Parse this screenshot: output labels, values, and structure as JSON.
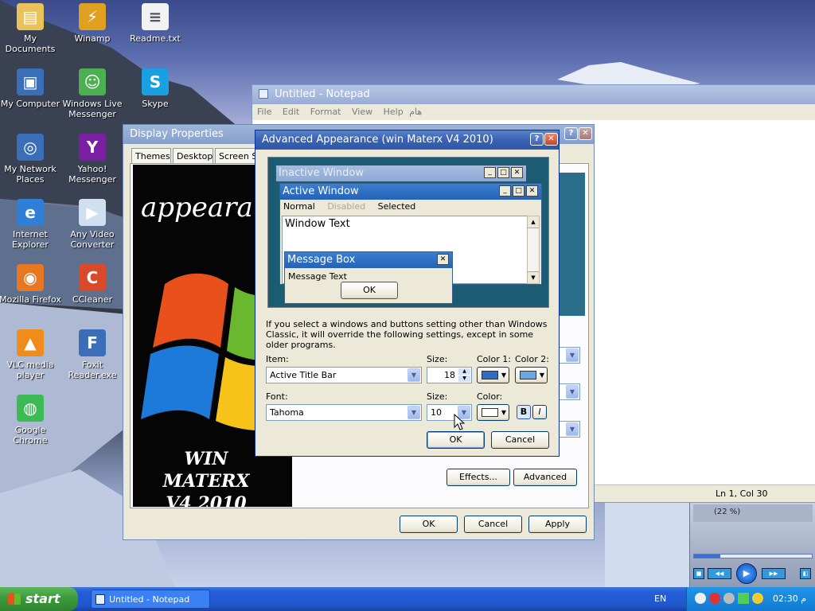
{
  "desktop_icons": [
    {
      "label": "My Documents",
      "icon": "folder-icon",
      "color": "#e8c25a"
    },
    {
      "label": "Winamp",
      "icon": "winamp-icon",
      "color": "#e0a020"
    },
    {
      "label": "Readme.txt",
      "icon": "text-file-icon",
      "color": "#f2f2f2"
    },
    {
      "label": "My Computer",
      "icon": "computer-icon",
      "color": "#3a6fb8"
    },
    {
      "label": "Windows Live Messenger",
      "icon": "messenger-icon",
      "color": "#4caf50"
    },
    {
      "label": "Skype",
      "icon": "skype-icon",
      "color": "#1aa0e0"
    },
    {
      "label": "My Network Places",
      "icon": "network-icon",
      "color": "#3a6fb8"
    },
    {
      "label": "Yahoo! Messenger",
      "icon": "yahoo-icon",
      "color": "#7b1fa2"
    },
    {
      "label": "Internet Explorer",
      "icon": "ie-icon",
      "color": "#2f7fd6"
    },
    {
      "label": "Any Video Converter",
      "icon": "video-converter-icon",
      "color": "#d0e0f0"
    },
    {
      "label": "Mozilla Firefox",
      "icon": "firefox-icon",
      "color": "#e87722"
    },
    {
      "label": "CCleaner",
      "icon": "ccleaner-icon",
      "color": "#d84a2a"
    },
    {
      "label": "VLC media player",
      "icon": "vlc-icon",
      "color": "#f08c1a"
    },
    {
      "label": "Foxit Reader.exe",
      "icon": "foxit-icon",
      "color": "#3a6fb8"
    },
    {
      "label": "Google Chrome",
      "icon": "chrome-icon",
      "color": "#3cba54"
    }
  ],
  "notepad": {
    "title": "Untitled - Notepad",
    "menu": [
      "File",
      "Edit",
      "Format",
      "View",
      "Help",
      "هام"
    ],
    "status": "Ln 1, Col 30"
  },
  "display_properties": {
    "title": "Display Properties",
    "tabs": [
      "Themes",
      "Desktop",
      "Screen Sa"
    ],
    "preview_text": "appearan",
    "preview_brand": "WIN MATERX V4 2010",
    "effects": "Effects...",
    "advanced": "Advanced",
    "ok": "OK",
    "cancel": "Cancel",
    "apply": "Apply"
  },
  "advanced_appearance": {
    "title": "Advanced Appearance (win  Materx V4 2010)",
    "preview": {
      "inactive": "Inactive Window",
      "active": "Active Window",
      "menu_normal": "Normal",
      "menu_disabled": "Disabled",
      "menu_selected": "Selected",
      "window_text": "Window Text",
      "msgbox_title": "Message Box",
      "msgbox_text": "Message Text",
      "msgbox_ok": "OK"
    },
    "info": "If you select a windows and buttons setting other than Windows Classic, it will override the following settings, except in some older programs.",
    "item_label": "Item:",
    "item_value": "Active Title Bar",
    "size_label": "Size:",
    "size_value": "18",
    "color1_label": "Color 1:",
    "color2_label": "Color 2:",
    "font_label": "Font:",
    "font_value": "Tahoma",
    "font_size_label": "Size:",
    "font_size_value": "10",
    "color_label": "Color:",
    "bold": "B",
    "italic": "I",
    "ok": "OK",
    "cancel": "Cancel",
    "color1": "#2e6dc4",
    "color2": "#6aa6e0"
  },
  "media_player": {
    "percent": "(22 %)",
    "progress": 0.22
  },
  "taskbar": {
    "start": "start",
    "task": "Untitled - Notepad",
    "lang": "EN",
    "clock": "02:30 م"
  }
}
